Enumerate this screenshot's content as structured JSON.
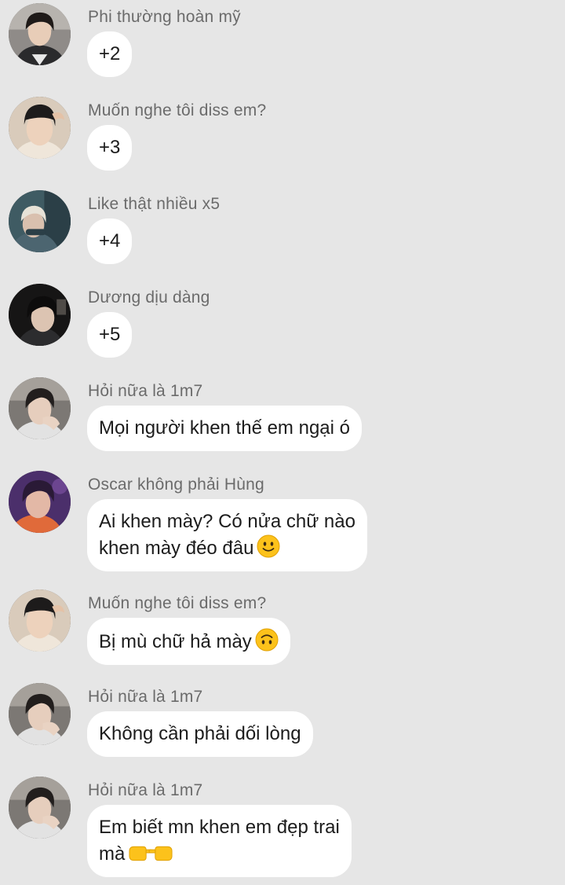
{
  "messages": [
    {
      "sender": "Phi thường hoàn mỹ",
      "text": "+2",
      "avatar": "avatar-boy-fringe"
    },
    {
      "sender": "Muốn nghe tôi diss em?",
      "text": "+3",
      "avatar": "avatar-boy-beanie"
    },
    {
      "sender": "Like thật nhiều x5",
      "text": "+4",
      "avatar": "avatar-boy-blond"
    },
    {
      "sender": "Dương dịu dàng",
      "text": "+5",
      "avatar": "avatar-boy-dark"
    },
    {
      "sender": "Hỏi nữa là 1m7",
      "text": "Mọi người khen thế em ngại ó",
      "avatar": "avatar-boy-hand"
    },
    {
      "sender": "Oscar không phải Hùng",
      "line1": "Ai khen mày? Có nửa chữ nào",
      "line2": "khen mày đéo đâu",
      "emoji": "slightly-smiling-face-icon",
      "avatar": "avatar-boy-purple"
    },
    {
      "sender": "Muốn nghe tôi diss em?",
      "text": "Bị mù chữ hả mày",
      "emoji": "upside-down-face-icon",
      "avatar": "avatar-boy-beanie"
    },
    {
      "sender": "Hỏi nữa là 1m7",
      "text": "Không cần phải dối lòng",
      "avatar": "avatar-boy-hand"
    },
    {
      "sender": "Hỏi nữa là 1m7",
      "line1": "Em biết mn khen em đẹp trai",
      "line2": "mà",
      "emoji": "pointing-fingers-icon",
      "avatar": "avatar-boy-hand"
    }
  ]
}
